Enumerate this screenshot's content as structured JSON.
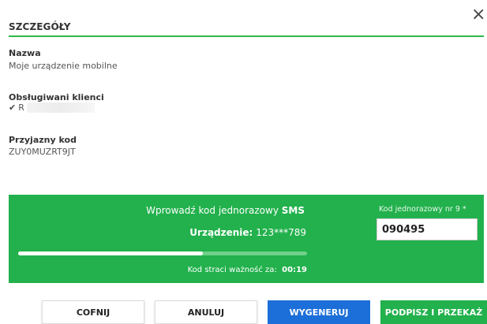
{
  "dialog": {
    "close_symbol": "×",
    "section_title": "SZCZEGÓŁY"
  },
  "details": {
    "name_label": "Nazwa",
    "name_value": "Moje urządzenie mobilne",
    "clients_label": "Obsługiwani klienci",
    "client_initial": "R",
    "friendly_code_label": "Przyjazny kod",
    "friendly_code_value": "ZUY0MUZRT9JT"
  },
  "sms_panel": {
    "prompt_prefix": "Wprowadź kod jednorazowy ",
    "prompt_emphasis": "SMS",
    "device_label": "Urządzenie:",
    "device_value": "123***789",
    "progress_fraction": 0.64,
    "expiry_label": "Kod straci ważność za:",
    "expiry_value": "00:19",
    "code_field_label": "Kod jednorazowy nr 9 *",
    "code_field_value": "090495"
  },
  "buttons": {
    "back": "COFNIJ",
    "cancel": "ANULUJ",
    "generate": "WYGENERUJ",
    "sign": "PODPISZ I PRZEKAŻ"
  },
  "colors": {
    "accent_green": "#22b14c",
    "primary_blue": "#1c6fd8"
  },
  "icons": {
    "close": "close-icon",
    "check": "check-icon"
  }
}
